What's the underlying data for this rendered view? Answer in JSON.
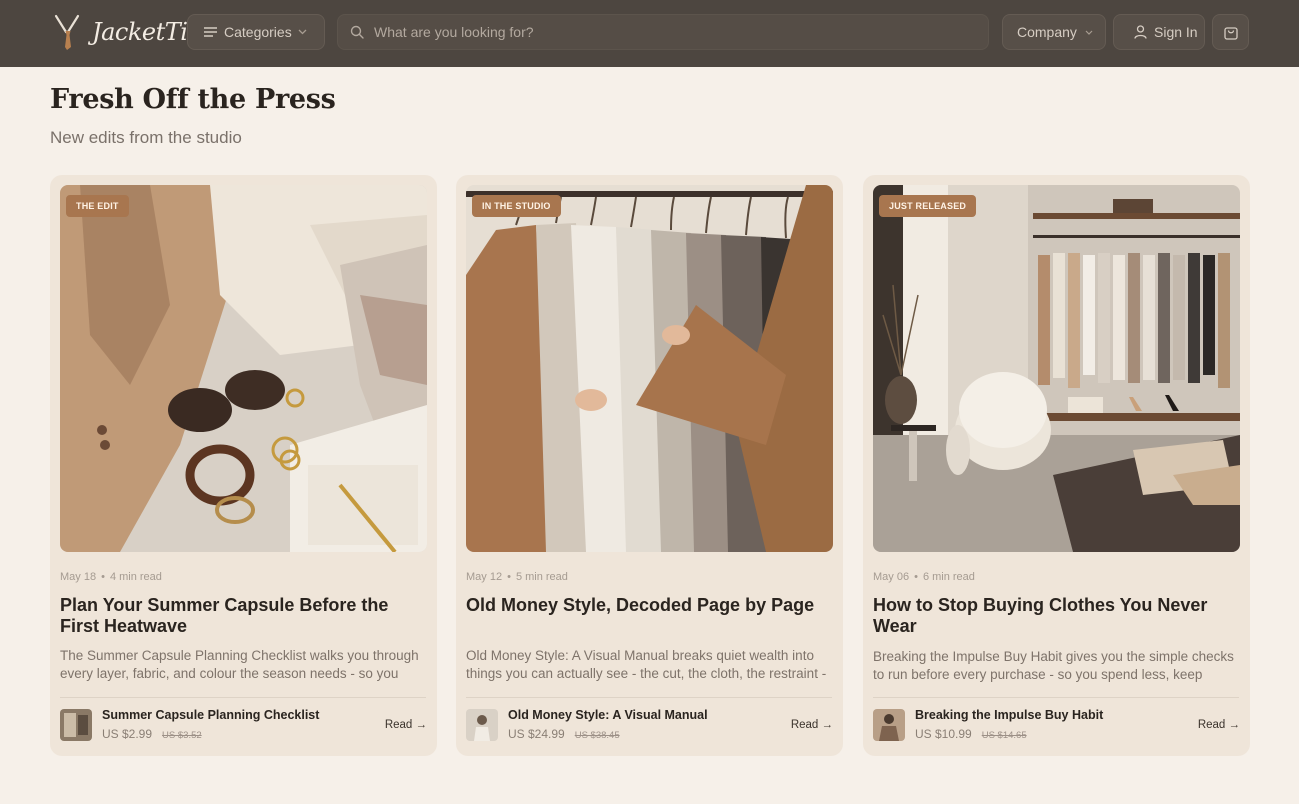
{
  "header": {
    "brand": "JacketTie",
    "categories_label": "Categories",
    "search_placeholder": "What are you looking for?",
    "company_label": "Company",
    "signin_label": "Sign In"
  },
  "section": {
    "title": "Fresh Off the Press",
    "subtitle": "New edits from the studio"
  },
  "cards": [
    {
      "badge": "THE EDIT",
      "date": "May 18",
      "read_time": "4 min read",
      "title": "Plan Your Summer Capsule Before the First Heatwave",
      "description": "The Summer Capsule Planning Checklist walks you through every layer, fabric, and colour the season needs - so you pack",
      "product_name": "Summer Capsule Planning Checklist",
      "price": "US $2.99",
      "old_price": "US $3.52",
      "read_label": "Read →"
    },
    {
      "badge": "IN THE STUDIO",
      "date": "May 12",
      "read_time": "5 min read",
      "title": "Old Money Style, Decoded Page by Page",
      "description": "Old Money Style: A Visual Manual breaks quiet wealth into things you can actually see - the cut, the cloth, the restraint -",
      "product_name": "Old Money Style: A Visual Manual",
      "price": "US $24.99",
      "old_price": "US $38.45",
      "read_label": "Read →"
    },
    {
      "badge": "JUST RELEASED",
      "date": "May 06",
      "read_time": "6 min read",
      "title": "How to Stop Buying Clothes You Never Wear",
      "description": "Breaking the Impulse Buy Habit gives you the simple checks to run before every purchase - so you spend less, keep more,",
      "product_name": "Breaking the Impulse Buy Habit",
      "price": "US $10.99",
      "old_price": "US $14.65",
      "read_label": "Read →"
    }
  ],
  "colors": {
    "header_bg": "#4d4640",
    "page_bg": "#f6f0e9",
    "card_bg": "#efe5d9",
    "badge_bg": "#a8764f"
  },
  "icons": {
    "categories": "menu-lines-icon",
    "search": "search-icon",
    "signin": "person-icon",
    "cart": "shopping-bag-icon"
  }
}
